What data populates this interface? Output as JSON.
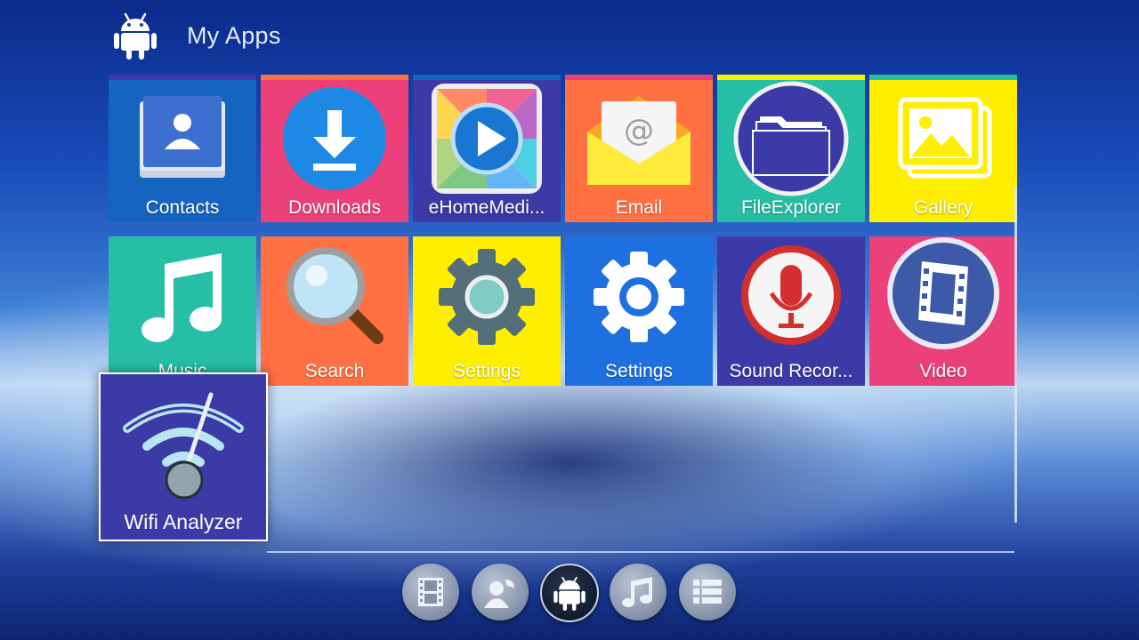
{
  "header": {
    "title": "My Apps",
    "logo_icon": "android-icon"
  },
  "tiles": [
    {
      "label": "Contacts",
      "icon": "contacts-icon",
      "bg": "#1565c0",
      "bar": "#3b3aa6"
    },
    {
      "label": "Downloads",
      "icon": "download-icon",
      "bg": "#ec407a",
      "bar": "#ff7043"
    },
    {
      "label": "eHomeMedi...",
      "icon": "media-player-icon",
      "bg": "#3b3aa6",
      "bar": "#1565c0"
    },
    {
      "label": "Email",
      "icon": "email-icon",
      "bg": "#ff7043",
      "bar": "#ec407a"
    },
    {
      "label": "FileExplorer",
      "icon": "folder-icon",
      "bg": "#26bfa5",
      "bar": "#ffee00"
    },
    {
      "label": "Gallery",
      "icon": "gallery-icon",
      "bg": "#ffee00",
      "bar": "#26bfa5"
    },
    {
      "label": "Music",
      "icon": "music-note-icon",
      "bg": "#26bfa5"
    },
    {
      "label": "Search",
      "icon": "magnifier-icon",
      "bg": "#ff7043"
    },
    {
      "label": "Settings",
      "icon": "gear-icon",
      "bg": "#ffee00"
    },
    {
      "label": "Settings",
      "icon": "settings-gear-icon",
      "bg": "#1e6fe0"
    },
    {
      "label": "Sound Recor...",
      "icon": "microphone-icon",
      "bg": "#3b3aa6"
    },
    {
      "label": "Video",
      "icon": "film-strip-icon",
      "bg": "#ec407a"
    }
  ],
  "focused": {
    "label": "Wifi Analyzer",
    "icon": "wifi-analyzer-icon",
    "bg": "#3b3aa6"
  },
  "dock": [
    {
      "icon": "movies-icon",
      "active": false
    },
    {
      "icon": "contacts-icon",
      "active": false
    },
    {
      "icon": "android-icon",
      "active": true
    },
    {
      "icon": "music-icon",
      "active": false
    },
    {
      "icon": "list-icon",
      "active": false
    }
  ]
}
